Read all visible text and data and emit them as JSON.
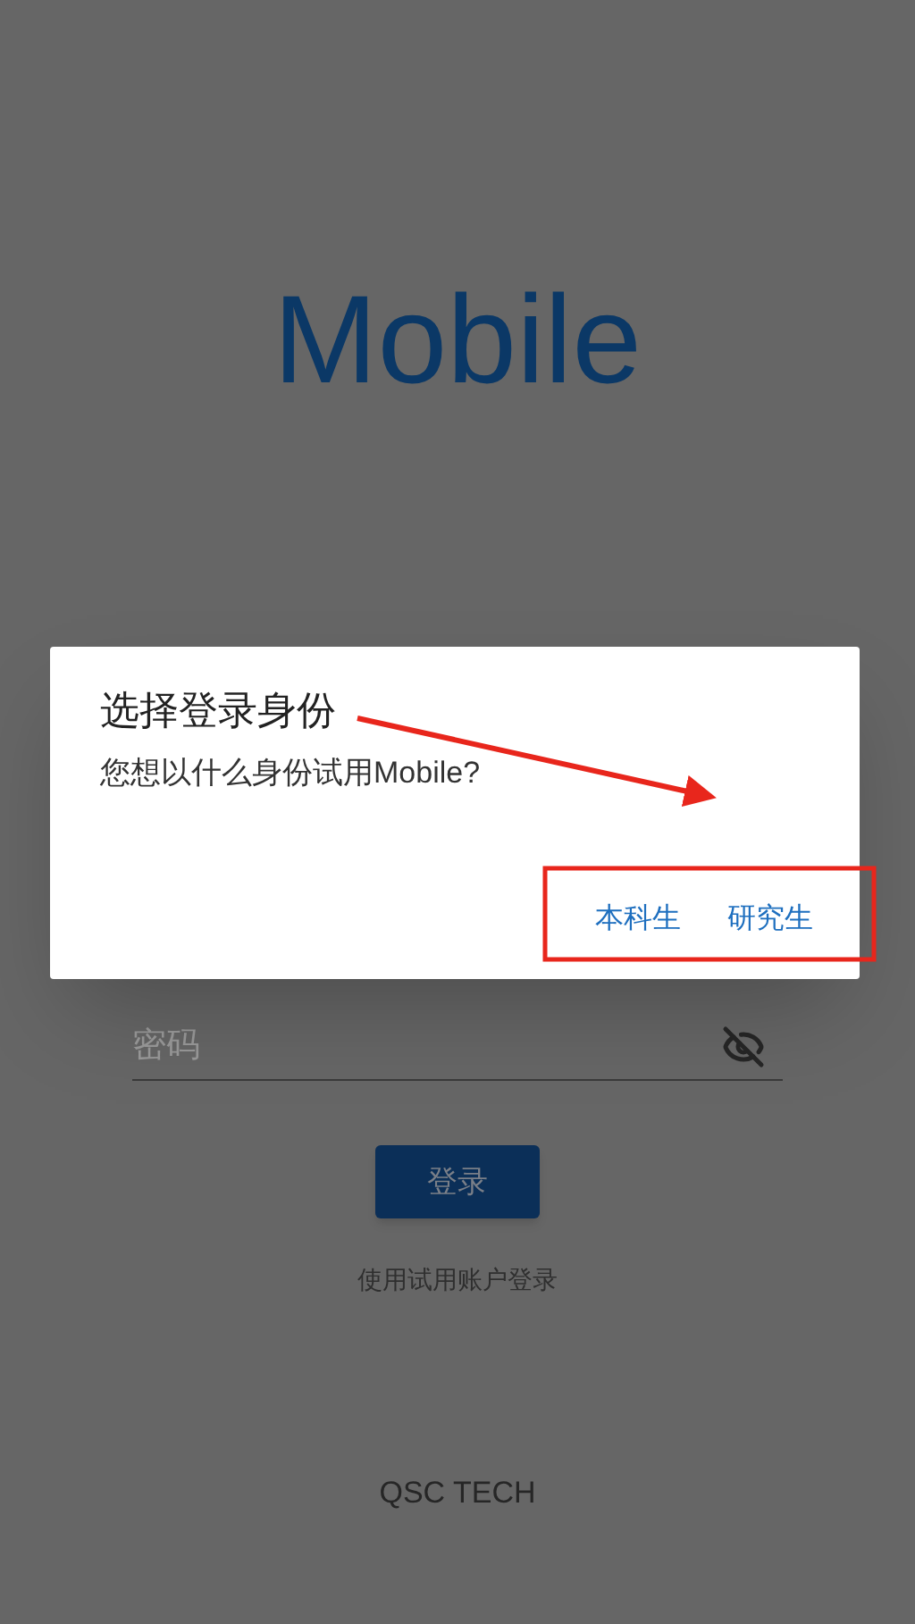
{
  "app_title": "Mobile",
  "password_field": {
    "placeholder": "密码"
  },
  "login_button": "登录",
  "trial_link": "使用试用账户登录",
  "footer": "QSC TECH",
  "dialog": {
    "title": "选择登录身份",
    "message": "您想以什么身份试用Mobile?",
    "actions": [
      "本科生",
      "研究生"
    ]
  }
}
